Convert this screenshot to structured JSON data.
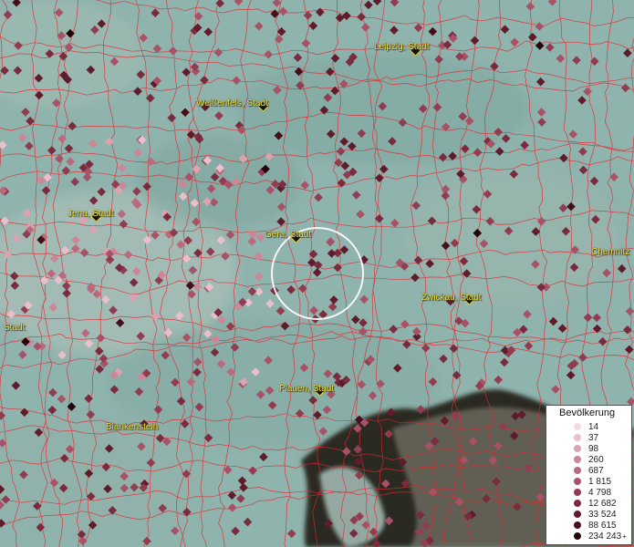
{
  "map": {
    "cities": [
      {
        "name": "Leipzig, Stadt"
      },
      {
        "name": "Weißenfels, Stadt"
      },
      {
        "name": "Jena, Stadt"
      },
      {
        "name": "Gera, Stadt"
      },
      {
        "name": "Chemnitz"
      },
      {
        "name": "Zwickau, Stadt"
      },
      {
        "name": "Stadt"
      },
      {
        "name": "Plauen, Stadt"
      },
      {
        "name": "Blankenstein"
      }
    ]
  },
  "legend": {
    "title": "Bevölkerung",
    "items": [
      {
        "label": "14",
        "color": "#f3d9e1"
      },
      {
        "label": "37",
        "color": "#e9bfcb"
      },
      {
        "label": "98",
        "color": "#dca2b1"
      },
      {
        "label": "260",
        "color": "#cd8598"
      },
      {
        "label": "687",
        "color": "#bb6a7e"
      },
      {
        "label": "1 815",
        "color": "#a75266"
      },
      {
        "label": "4 798",
        "color": "#913d51"
      },
      {
        "label": "12 682",
        "color": "#7a2b3d"
      },
      {
        "label": "33 524",
        "color": "#611c2b"
      },
      {
        "label": "88 615",
        "color": "#46101b"
      },
      {
        "label": "234 243",
        "color": "#22060a",
        "plus": "+"
      }
    ]
  },
  "colors": {
    "background": "#8fb3ad",
    "boundary": "#e8242e",
    "city_label": "#f2e64a",
    "dark_region": "#2b2a24",
    "selection_ring": "#ffffff"
  }
}
